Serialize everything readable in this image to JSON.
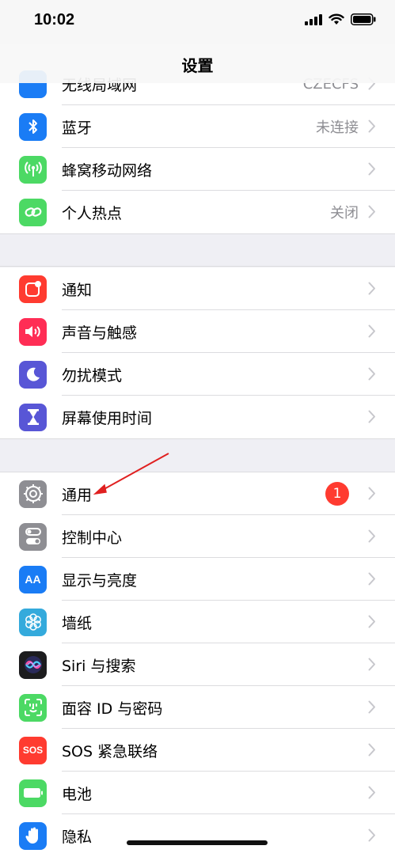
{
  "status_bar": {
    "time": "10:02"
  },
  "nav": {
    "title": "设置"
  },
  "group1": {
    "cut_row": {
      "label": "无线局域网",
      "detail": "CZECFS"
    },
    "bluetooth": {
      "label": "蓝牙",
      "detail": "未连接"
    },
    "cellular": {
      "label": "蜂窝移动网络"
    },
    "hotspot": {
      "label": "个人热点",
      "detail": "关闭"
    }
  },
  "group2": {
    "notifications": {
      "label": "通知"
    },
    "sounds": {
      "label": "声音与触感"
    },
    "dnd": {
      "label": "勿扰模式"
    },
    "screen_time": {
      "label": "屏幕使用时间"
    }
  },
  "group3": {
    "general": {
      "label": "通用",
      "badge": "1"
    },
    "control_center": {
      "label": "控制中心"
    },
    "display": {
      "label": "显示与亮度",
      "icon_text": "AA"
    },
    "wallpaper": {
      "label": "墙纸"
    },
    "siri": {
      "label": "Siri 与搜索"
    },
    "face_id": {
      "label": "面容 ID 与密码"
    },
    "sos": {
      "label": "SOS 紧急联络",
      "icon_text": "SOS"
    },
    "battery": {
      "label": "电池"
    },
    "privacy": {
      "label": "隐私"
    }
  },
  "colors": {
    "arrow": "#e02020",
    "badge": "#ff3b30",
    "bluetooth": "#1a7cf5",
    "cellular": "#4cd964",
    "notifications": "#ff3b30",
    "sounds": "#ff2d55",
    "dnd": "#5856d6",
    "screen_time": "#5856d6",
    "general": "#8e8e93",
    "display": "#1a7cf5",
    "wallpaper": "#34aadc",
    "sos": "#ff3b30",
    "battery": "#4cd964"
  }
}
